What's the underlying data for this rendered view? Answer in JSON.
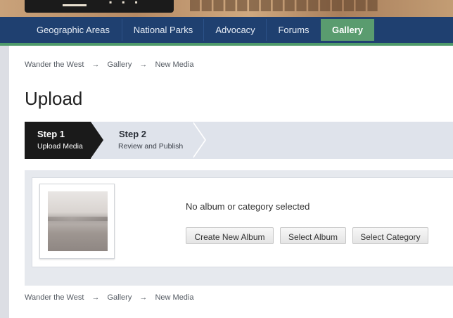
{
  "nav": {
    "items": [
      {
        "label": "Geographic Areas",
        "active": false
      },
      {
        "label": "National Parks",
        "active": false
      },
      {
        "label": "Advocacy",
        "active": false
      },
      {
        "label": "Forums",
        "active": false
      },
      {
        "label": "Gallery",
        "active": true
      }
    ]
  },
  "breadcrumb": {
    "items": [
      "Wander the West",
      "Gallery",
      "New Media"
    ],
    "separator": "→"
  },
  "page": {
    "title": "Upload"
  },
  "steps": [
    {
      "number": "Step 1",
      "label": "Upload Media",
      "active": true
    },
    {
      "number": "Step 2",
      "label": "Review and Publish",
      "active": false
    }
  ],
  "upload": {
    "status_text": "No album or category selected",
    "buttons": {
      "create_album": "Create New Album",
      "select_album": "Select Album",
      "select_category": "Select Category"
    }
  },
  "colors": {
    "nav_bg": "#1f4070",
    "nav_active": "#5a9c6f",
    "step_active": "#1a1a1a",
    "steps_bg": "#dfe3eb"
  }
}
